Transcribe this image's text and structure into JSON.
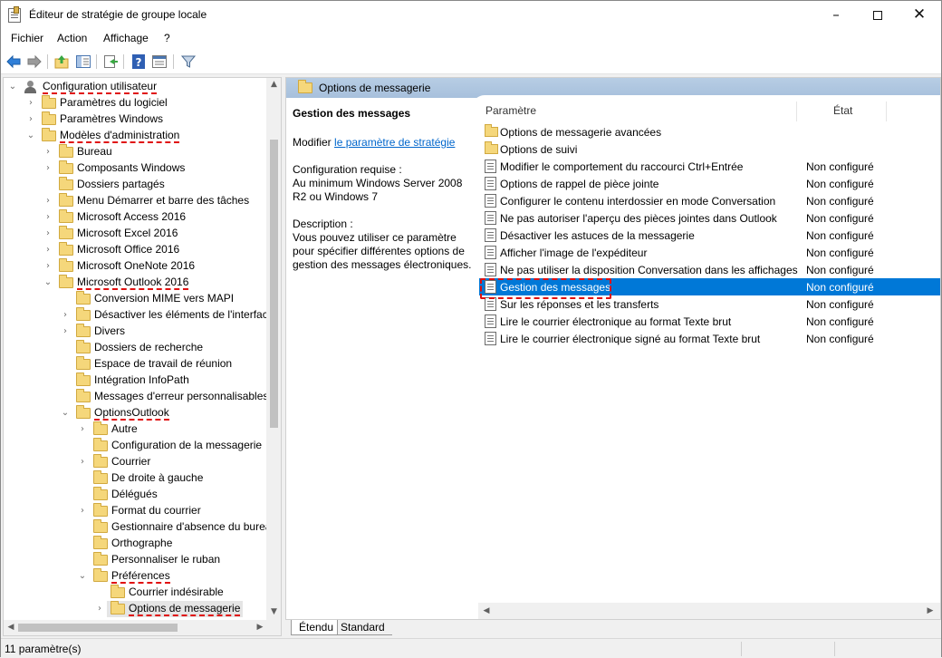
{
  "window": {
    "title": "Éditeur de stratégie de groupe locale"
  },
  "menu": [
    "Fichier",
    "Action",
    "Affichage",
    "?"
  ],
  "tree": {
    "root": "Configuration utilisateur",
    "items": [
      "Paramètres du logiciel",
      "Paramètres Windows",
      "Modèles d'administration",
      "Bureau",
      "Composants Windows",
      "Dossiers partagés",
      "Menu Démarrer et barre des tâches",
      "Microsoft Access 2016",
      "Microsoft Excel 2016",
      "Microsoft Office 2016",
      "Microsoft OneNote 2016",
      "Microsoft Outlook 2016",
      "Conversion MIME vers MAPI",
      "Désactiver les éléments de l'interface",
      "Divers",
      "Dossiers de recherche",
      "Espace de travail de réunion",
      "Intégration InfoPath",
      "Messages d'erreur personnalisables",
      "OptionsOutlook",
      "Autre",
      "Configuration de la messagerie",
      "Courrier",
      "De droite à gauche",
      "Délégués",
      "Format du courrier",
      "Gestionnaire d'absence du bureau",
      "Orthographe",
      "Personnaliser le ruban",
      "Préférences",
      "Courrier indésirable",
      "Options de messagerie"
    ]
  },
  "details": {
    "header": "Options de messagerie",
    "title": "Gestion des messages",
    "edit_prefix": "Modifier",
    "edit_link": "le paramètre de stratégie",
    "requirements_label": "Configuration requise :",
    "requirements_text": "Au minimum Windows Server 2008 R2 ou Windows 7",
    "description_label": "Description :",
    "description_text": "Vous pouvez utiliser ce paramètre pour spécifier différentes options de gestion des messages électroniques."
  },
  "list": {
    "col_setting": "Paramètre",
    "col_state": "État",
    "rows": [
      {
        "name": "Options de messagerie avancées",
        "state": ""
      },
      {
        "name": "Options de suivi",
        "state": ""
      },
      {
        "name": "Modifier le comportement du raccourci Ctrl+Entrée",
        "state": "Non configuré"
      },
      {
        "name": "Options de rappel de pièce jointe",
        "state": "Non configuré"
      },
      {
        "name": "Configurer le contenu interdossier en mode Conversation",
        "state": "Non configuré"
      },
      {
        "name": "Ne pas autoriser l'aperçu des pièces jointes dans Outlook",
        "state": "Non configuré"
      },
      {
        "name": "Désactiver les astuces de la messagerie",
        "state": "Non configuré"
      },
      {
        "name": "Afficher l'image de l'expéditeur",
        "state": "Non configuré"
      },
      {
        "name": "Ne pas utiliser la disposition Conversation dans les affichages",
        "state": "Non configuré"
      },
      {
        "name": "Gestion des messages",
        "state": "Non configuré"
      },
      {
        "name": "Sur les réponses et les transferts",
        "state": "Non configuré"
      },
      {
        "name": "Lire le courrier électronique au format Texte brut",
        "state": "Non configuré"
      },
      {
        "name": "Lire le courrier électronique signé au format Texte brut",
        "state": "Non configuré"
      }
    ]
  },
  "tabs": [
    "Étendu",
    "Standard"
  ],
  "status": "11 paramètre(s)",
  "colors": {
    "selection": "#0078d7",
    "annotation": "#e01010",
    "header_band": "#a7c0dc"
  }
}
